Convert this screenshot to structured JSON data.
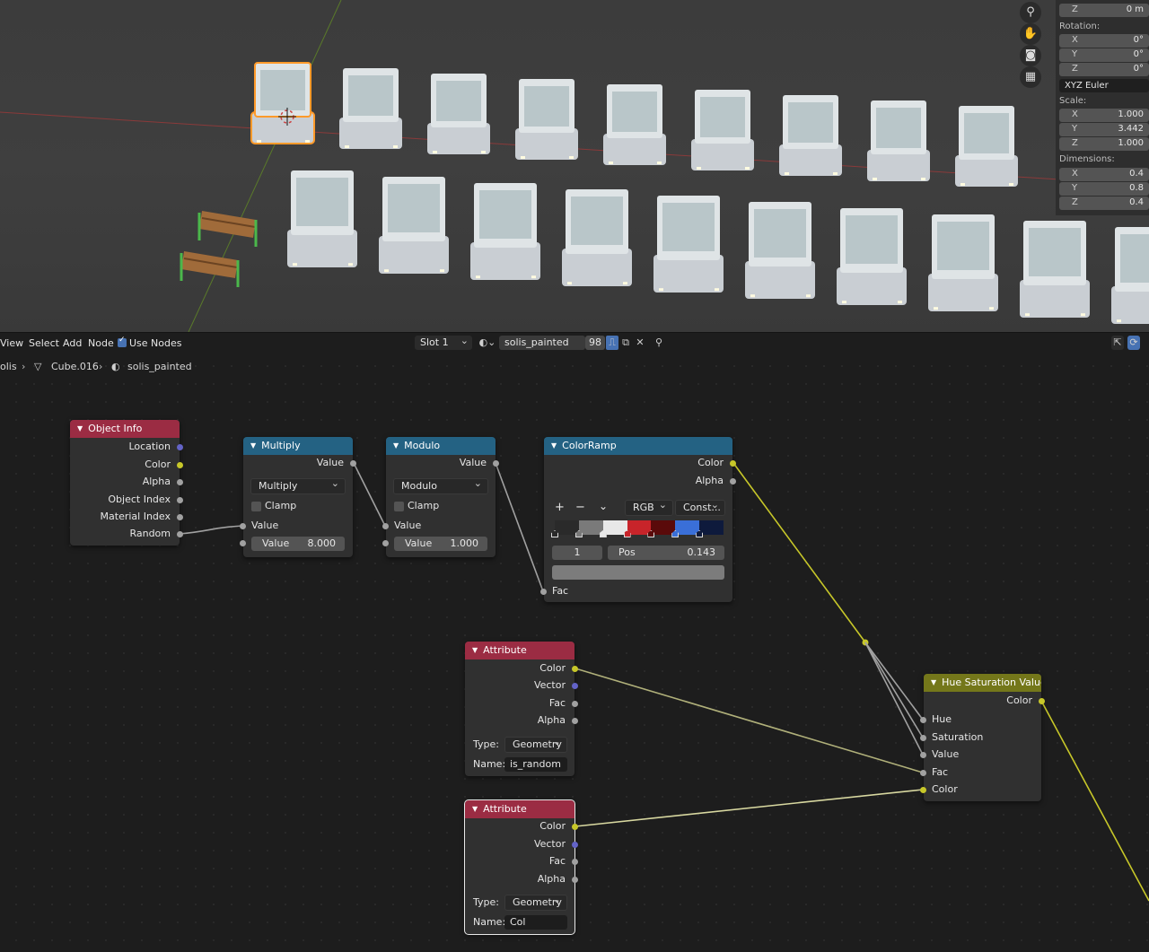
{
  "npanel": {
    "loc_z": {
      "axis": "Z",
      "value": "0 m"
    },
    "rotation_label": "Rotation:",
    "rotation": [
      {
        "axis": "X",
        "value": "0°"
      },
      {
        "axis": "Y",
        "value": "0°"
      },
      {
        "axis": "Z",
        "value": "0°"
      }
    ],
    "rotation_mode": "XYZ Euler",
    "scale_label": "Scale:",
    "scale": [
      {
        "axis": "X",
        "value": "1.000"
      },
      {
        "axis": "Y",
        "value": "3.442"
      },
      {
        "axis": "Z",
        "value": "1.000"
      }
    ],
    "dimensions_label": "Dimensions:",
    "dimensions": [
      {
        "axis": "X",
        "value": "0.4"
      },
      {
        "axis": "Y",
        "value": "0.8"
      },
      {
        "axis": "Z",
        "value": "0.4"
      }
    ]
  },
  "gizmo_icons": [
    "zoom-icon",
    "hand-pan-icon",
    "camera-icon",
    "grid-view-icon"
  ],
  "header": {
    "menus": [
      "View",
      "Select",
      "Add",
      "Node"
    ],
    "use_nodes_label": "Use Nodes",
    "slot": "Slot 1",
    "material_name": "solis_painted",
    "user_count": "98"
  },
  "breadcrumb": {
    "root": "olis",
    "object": "Cube.016",
    "material": "solis_painted"
  },
  "nodes": {
    "object_info": {
      "title": "Object Info",
      "outputs": [
        "Location",
        "Color",
        "Alpha",
        "Object Index",
        "Material Index",
        "Random"
      ]
    },
    "multiply": {
      "title": "Multiply",
      "output": "Value",
      "operation": "Multiply",
      "clamp_label": "Clamp",
      "input_label": "Value",
      "field_label": "Value",
      "field_value": "8.000"
    },
    "modulo": {
      "title": "Modulo",
      "output": "Value",
      "operation": "Modulo",
      "clamp_label": "Clamp",
      "input_label": "Value",
      "field_label": "Value",
      "field_value": "1.000"
    },
    "colorramp": {
      "title": "ColorRamp",
      "outputs": [
        "Color",
        "Alpha"
      ],
      "plus": "+",
      "minus": "−",
      "chevron": "⌄",
      "color_mode": "RGB",
      "interpolation": "Const...",
      "stop_index": "1",
      "pos_label": "Pos",
      "pos_value": "0.143",
      "input": "Fac",
      "stops": [
        "#2a2a2a",
        "#7a7a7a",
        "#e8e8e8",
        "#c8242a",
        "#5a0a0a",
        "#3a6fd8",
        "#0e1a3c"
      ]
    },
    "attribute1": {
      "title": "Attribute",
      "outputs": [
        "Color",
        "Vector",
        "Fac",
        "Alpha"
      ],
      "type_label": "Type:",
      "type_value": "Geometry",
      "name_label": "Name:",
      "name_value": "is_random"
    },
    "attribute2": {
      "title": "Attribute",
      "outputs": [
        "Color",
        "Vector",
        "Fac",
        "Alpha"
      ],
      "type_label": "Type:",
      "type_value": "Geometry",
      "name_label": "Name:",
      "name_value": "Col"
    },
    "hsv": {
      "title": "Hue Saturation Value",
      "output": "Color",
      "inputs": [
        "Hue",
        "Saturation",
        "Value",
        "Fac",
        "Color"
      ]
    }
  },
  "colors": {
    "header_red": "#9b2c43",
    "header_blue": "#246283",
    "header_olive": "#74771a",
    "socket_yellow": "#c7c729",
    "socket_grey": "#a1a1a1",
    "socket_purple": "#6363c7",
    "accent": "#4772b3"
  }
}
